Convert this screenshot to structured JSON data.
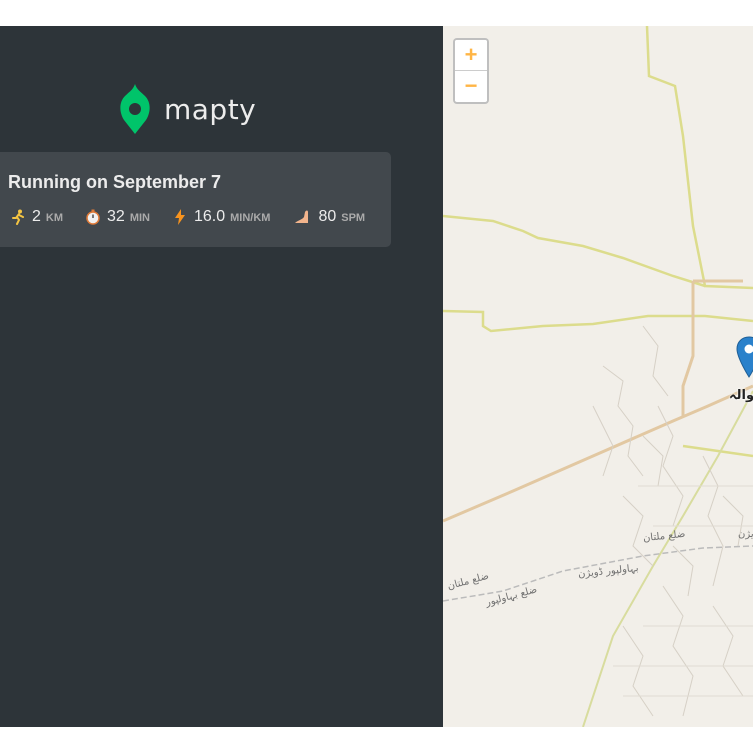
{
  "app": {
    "name": "mapty"
  },
  "workouts": [
    {
      "title": "Running on September 7",
      "stats": [
        {
          "icon": "runner-icon",
          "value": "2",
          "unit": "km"
        },
        {
          "icon": "stopwatch-icon",
          "value": "32",
          "unit": "min"
        },
        {
          "icon": "lightning-icon",
          "value": "16.0",
          "unit": "min/km"
        },
        {
          "icon": "footprint-icon",
          "value": "80",
          "unit": "spm"
        }
      ]
    }
  ],
  "map": {
    "zoom_in": "+",
    "zoom_out": "−",
    "city": "روالہ",
    "labels": [
      "ضلع ملتان",
      "بہاولپور ڈویژن",
      "ضلع ملتان",
      "ضلع بہاولپور",
      "ڈویژن"
    ]
  },
  "colors": {
    "sidebar_bg": "#2d3439",
    "card_bg": "#42484d",
    "brand_green": "#00c46a",
    "accent_orange": "#ffb545",
    "marker_blue": "#2a81cb"
  }
}
